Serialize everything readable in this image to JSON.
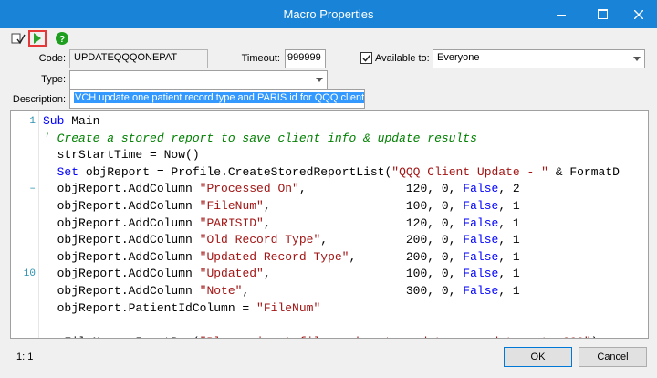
{
  "window": {
    "title": "Macro Properties"
  },
  "toolbar": {
    "check_icon": "check-list-icon",
    "run_icon": "play-icon",
    "help_icon": "help-icon"
  },
  "form": {
    "code_label": "Code:",
    "code_value": "UPDATEQQQONEPAT",
    "timeout_label": "Timeout:",
    "timeout_value": "999999",
    "available_label": "Available to:",
    "available_checked": true,
    "available_value": "Everyone",
    "type_label": "Type:",
    "type_value": "",
    "description_label": "Description:",
    "description_value": "VCH update one patient record type and PARIS id for QQQ clients"
  },
  "editor": {
    "lines": [
      {
        "n": "1",
        "parts": [
          {
            "t": "kw",
            "v": "Sub"
          },
          {
            "t": "",
            "v": " Main"
          }
        ]
      },
      {
        "n": "",
        "parts": [
          {
            "t": "cm",
            "v": "' Create a stored report to save client info & update results"
          }
        ]
      },
      {
        "n": "",
        "parts": [
          {
            "t": "",
            "v": "  strStartTime = Now()"
          }
        ]
      },
      {
        "n": "",
        "parts": [
          {
            "t": "kw",
            "v": "  Set"
          },
          {
            "t": "",
            "v": " objReport = Profile.CreateStoredReportList("
          },
          {
            "t": "st",
            "v": "\"QQQ Client Update - \""
          },
          {
            "t": "",
            "v": " & FormatD"
          }
        ]
      },
      {
        "n": "–",
        "parts": [
          {
            "t": "",
            "v": "  objReport.AddColumn "
          },
          {
            "t": "st",
            "v": "\"Processed On\""
          },
          {
            "t": "",
            "v": ",              120, 0, "
          },
          {
            "t": "kw",
            "v": "False"
          },
          {
            "t": "",
            "v": ", 2"
          }
        ]
      },
      {
        "n": "",
        "parts": [
          {
            "t": "",
            "v": "  objReport.AddColumn "
          },
          {
            "t": "st",
            "v": "\"FileNum\""
          },
          {
            "t": "",
            "v": ",                   100, 0, "
          },
          {
            "t": "kw",
            "v": "False"
          },
          {
            "t": "",
            "v": ", 1"
          }
        ]
      },
      {
        "n": "",
        "parts": [
          {
            "t": "",
            "v": "  objReport.AddColumn "
          },
          {
            "t": "st",
            "v": "\"PARISID\""
          },
          {
            "t": "",
            "v": ",                   120, 0, "
          },
          {
            "t": "kw",
            "v": "False"
          },
          {
            "t": "",
            "v": ", 1"
          }
        ]
      },
      {
        "n": "",
        "parts": [
          {
            "t": "",
            "v": "  objReport.AddColumn "
          },
          {
            "t": "st",
            "v": "\"Old Record Type\""
          },
          {
            "t": "",
            "v": ",           200, 0, "
          },
          {
            "t": "kw",
            "v": "False"
          },
          {
            "t": "",
            "v": ", 1"
          }
        ]
      },
      {
        "n": "",
        "parts": [
          {
            "t": "",
            "v": "  objReport.AddColumn "
          },
          {
            "t": "st",
            "v": "\"Updated Record Type\""
          },
          {
            "t": "",
            "v": ",       200, 0, "
          },
          {
            "t": "kw",
            "v": "False"
          },
          {
            "t": "",
            "v": ", 1"
          }
        ]
      },
      {
        "n": "10",
        "parts": [
          {
            "t": "",
            "v": "  objReport.AddColumn "
          },
          {
            "t": "st",
            "v": "\"Updated\""
          },
          {
            "t": "",
            "v": ",                   100, 0, "
          },
          {
            "t": "kw",
            "v": "False"
          },
          {
            "t": "",
            "v": ", 1"
          }
        ]
      },
      {
        "n": "",
        "parts": [
          {
            "t": "",
            "v": "  objReport.AddColumn "
          },
          {
            "t": "st",
            "v": "\"Note\""
          },
          {
            "t": "",
            "v": ",                      300, 0, "
          },
          {
            "t": "kw",
            "v": "False"
          },
          {
            "t": "",
            "v": ", 1"
          }
        ]
      },
      {
        "n": "",
        "parts": [
          {
            "t": "",
            "v": "  objReport.PatientIdColumn = "
          },
          {
            "t": "st",
            "v": "\"FileNum\""
          }
        ]
      },
      {
        "n": "",
        "parts": []
      },
      {
        "n": "",
        "parts": [
          {
            "t": "",
            "v": "  aFileNum = InputBox("
          },
          {
            "t": "st",
            "v": "\"Please input file number to update record type to GCO\""
          },
          {
            "t": "",
            "v": ")"
          }
        ]
      }
    ]
  },
  "status": {
    "cursor": "1: 1"
  },
  "buttons": {
    "ok": "OK",
    "cancel": "Cancel"
  }
}
